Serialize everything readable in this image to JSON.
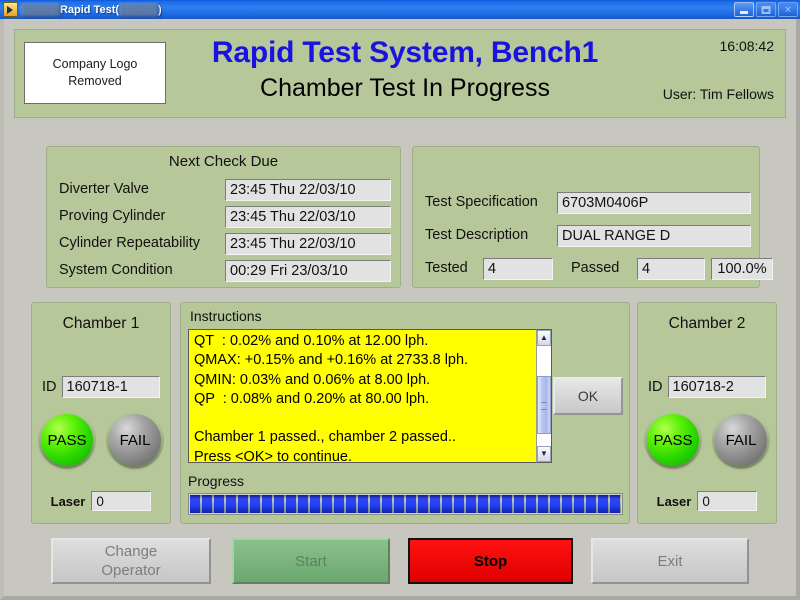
{
  "window": {
    "title_prefix_redacted": "█████ ",
    "title": "Rapid Test",
    "title_suffix_open": " (",
    "title_suffix_redacted": "█████",
    "title_suffix_close": ")",
    "icon": "app-icon",
    "minimize_label": "minimize-icon",
    "maximize_label": "maximize-icon",
    "close_label": "close-icon"
  },
  "header": {
    "logo_line1": "Company Logo",
    "logo_line2": "Removed",
    "title": "Rapid Test System, Bench1",
    "subtitle": "Chamber Test In Progress",
    "time": "16:08:42",
    "user": "User: Tim Fellows",
    "title_color": "#1a12e0",
    "panel_color": "#b6c79a"
  },
  "next_check_due": {
    "heading": "Next Check Due",
    "rows": [
      {
        "label": "Diverter Valve",
        "value": "23:45 Thu 22/03/10"
      },
      {
        "label": "Proving Cylinder",
        "value": "23:45 Thu 22/03/10"
      },
      {
        "label": "Cylinder Repeatability",
        "value": "23:45 Thu 22/03/10"
      },
      {
        "label": "System Condition",
        "value": "00:29 Fri 23/03/10"
      }
    ]
  },
  "test_info": {
    "spec_label": "Test Specification",
    "spec_value": "6703M0406P",
    "desc_label": "Test Description",
    "desc_value": "DUAL RANGE D",
    "tested_label": "Tested",
    "tested_value": "4",
    "passed_label": "Passed",
    "passed_value": "4",
    "percent_value": "100.0%"
  },
  "chamber1": {
    "title": "Chamber 1",
    "id_label": "ID",
    "id_value": "160718-1",
    "pass_label": "PASS",
    "fail_label": "FAIL",
    "pass_state": "on",
    "fail_state": "off",
    "laser_label": "Laser",
    "laser_value": "0"
  },
  "chamber2": {
    "title": "Chamber 2",
    "id_label": "ID",
    "id_value": "160718-2",
    "pass_label": "PASS",
    "fail_label": "FAIL",
    "pass_state": "on",
    "fail_state": "off",
    "laser_label": "Laser",
    "laser_value": "0"
  },
  "instructions": {
    "label": "Instructions",
    "text": "QT  : 0.02% and 0.10% at 12.00 lph.\nQMAX: +0.15% and +0.16% at 2733.8 lph.\nQMIN: 0.03% and 0.06% at 8.00 lph.\nQP  : 0.08% and 0.20% at 80.00 lph.\n\nChamber 1 passed., chamber 2 passed..\nPress <OK> to continue.",
    "background_color": "#ffff00",
    "ok_label": "OK",
    "scroll_up_icon": "▲",
    "scroll_down_icon": "▼"
  },
  "progress": {
    "label": "Progress",
    "percent": 100,
    "bar_color": "#1a2ef0"
  },
  "buttons": {
    "change_operator": "Change\nOperator",
    "change_operator_line1": "Change",
    "change_operator_line2": "Operator",
    "start": "Start",
    "stop": "Stop",
    "exit": "Exit"
  }
}
